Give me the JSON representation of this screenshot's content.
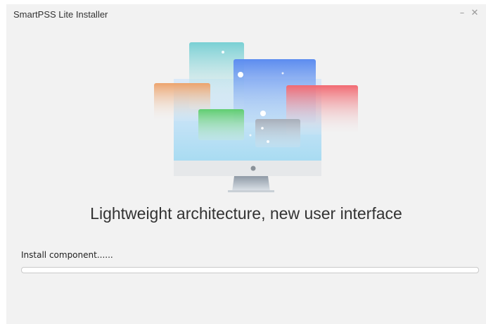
{
  "window": {
    "title": "SmartPSS Lite Installer",
    "minimize_glyph": "–",
    "close_glyph": "✕"
  },
  "tagline": "Lightweight architecture, new user interface",
  "install": {
    "status_text": "Install component......",
    "progress": 0
  },
  "colors": {
    "window_bg": "#f2f2f2",
    "progress_fill": "#3a86d8",
    "teal_card": "#7fd3d6",
    "orange_card": "#eda36c",
    "blue_screen": "#5f8ff0",
    "red_card": "#f26a72",
    "green_card": "#63cf73",
    "gray_card": "#a9b0bb"
  },
  "icons": {
    "minimize": "minimize-icon",
    "close": "close-icon",
    "illustration": "monitor-with-windows-illustration"
  }
}
